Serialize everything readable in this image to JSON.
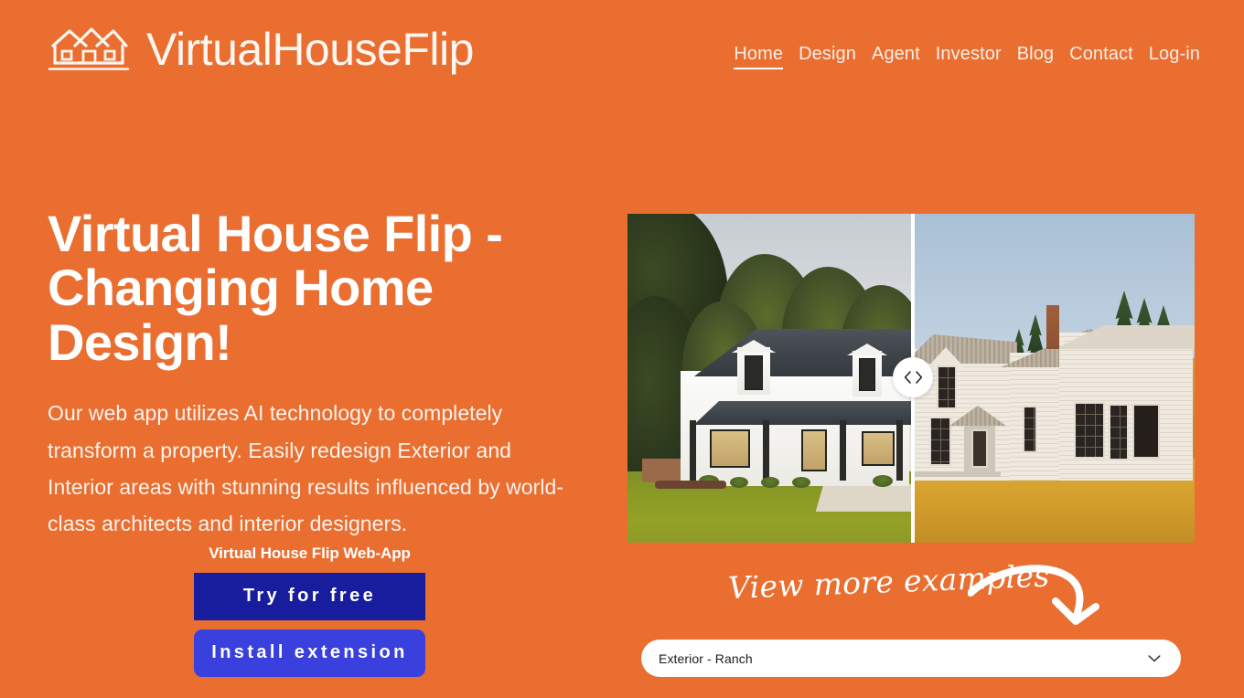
{
  "brand": {
    "name": "VirtualHouseFlip",
    "logo_icon": "house-outline-icon"
  },
  "nav": {
    "items": [
      {
        "label": "Home",
        "active": true
      },
      {
        "label": "Design",
        "active": false
      },
      {
        "label": "Agent",
        "active": false
      },
      {
        "label": "Investor",
        "active": false
      },
      {
        "label": "Blog",
        "active": false
      },
      {
        "label": "Contact",
        "active": false
      },
      {
        "label": "Log-in",
        "active": false
      }
    ]
  },
  "hero": {
    "headline": "Virtual House Flip - Changing Home Design!",
    "subcopy": "Our web app utilizes AI technology to completely transform a property. Easily redesign Exterior and Interior areas with stunning results influenced by world-class architects and interior designers."
  },
  "cta": {
    "label": "Virtual House Flip Web-App",
    "primary_button": "Try for free",
    "secondary_button": "Install extension"
  },
  "comparison": {
    "handle_icon_left": "chevron-left-icon",
    "handle_icon_right": "chevron-right-icon",
    "before_alt": "Modern white farmhouse with dark shingle roof and green lawn",
    "after_alt": "Old weathered white farmhouse in golden dry grass field"
  },
  "examples": {
    "caption": "View more examples",
    "arrow_icon": "curved-arrow-down-icon"
  },
  "selector": {
    "value": "Exterior - Ranch",
    "chevron_icon": "chevron-down-icon"
  },
  "colors": {
    "background": "#e96e30",
    "text_on_orange": "#ffffff",
    "primary_button": "#181d9e",
    "secondary_button": "#3a40de",
    "select_background": "#ffffff"
  }
}
